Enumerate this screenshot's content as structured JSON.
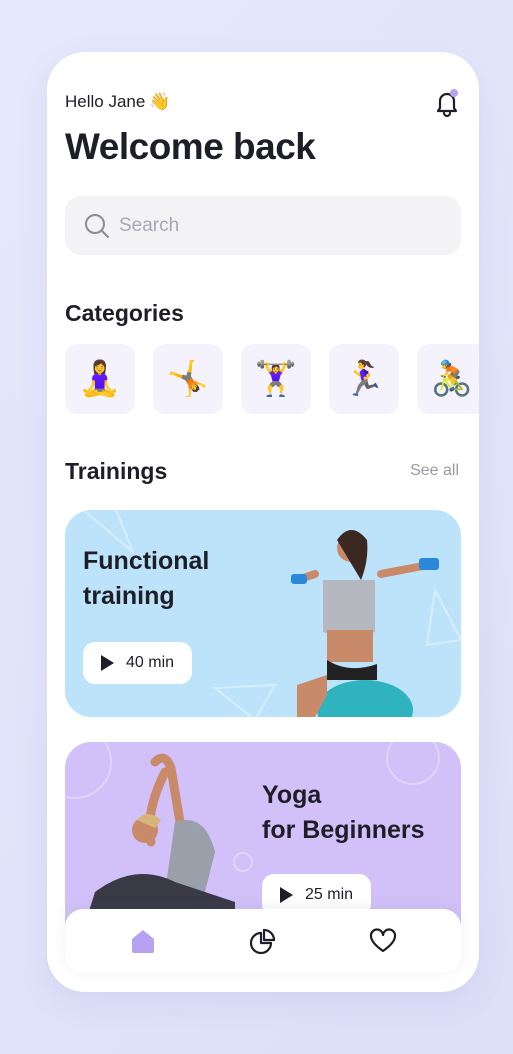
{
  "header": {
    "greeting": "Hello Jane",
    "wave_emoji": "👋",
    "title": "Welcome back",
    "bell_icon": "bell-icon",
    "notification_dot_color": "#b7a2f2"
  },
  "search": {
    "placeholder": "Search",
    "icon": "search-icon"
  },
  "categories": {
    "title": "Categories",
    "items": [
      {
        "icon": "meditation-icon",
        "emoji": "🧘‍♀️"
      },
      {
        "icon": "cartwheel-icon",
        "emoji": "🤸"
      },
      {
        "icon": "weightlifting-icon",
        "emoji": "🏋️‍♀️"
      },
      {
        "icon": "running-icon",
        "emoji": "🏃‍♀️"
      },
      {
        "icon": "cycling-icon",
        "emoji": "🚴"
      }
    ]
  },
  "trainings": {
    "title": "Trainings",
    "see_all": "See all",
    "cards": [
      {
        "title_line1": "Functional",
        "title_line2": "training",
        "duration": "40 min",
        "color": "#bde3fb"
      },
      {
        "title_line1": "Yoga",
        "title_line2": "for Beginners",
        "duration": "25 min",
        "color": "#d1c1f8"
      }
    ]
  },
  "nav": {
    "items": [
      {
        "icon": "home-icon",
        "active": true
      },
      {
        "icon": "pie-chart-icon",
        "active": false
      },
      {
        "icon": "heart-icon",
        "active": false
      }
    ],
    "accent": "#b7a2f2"
  }
}
